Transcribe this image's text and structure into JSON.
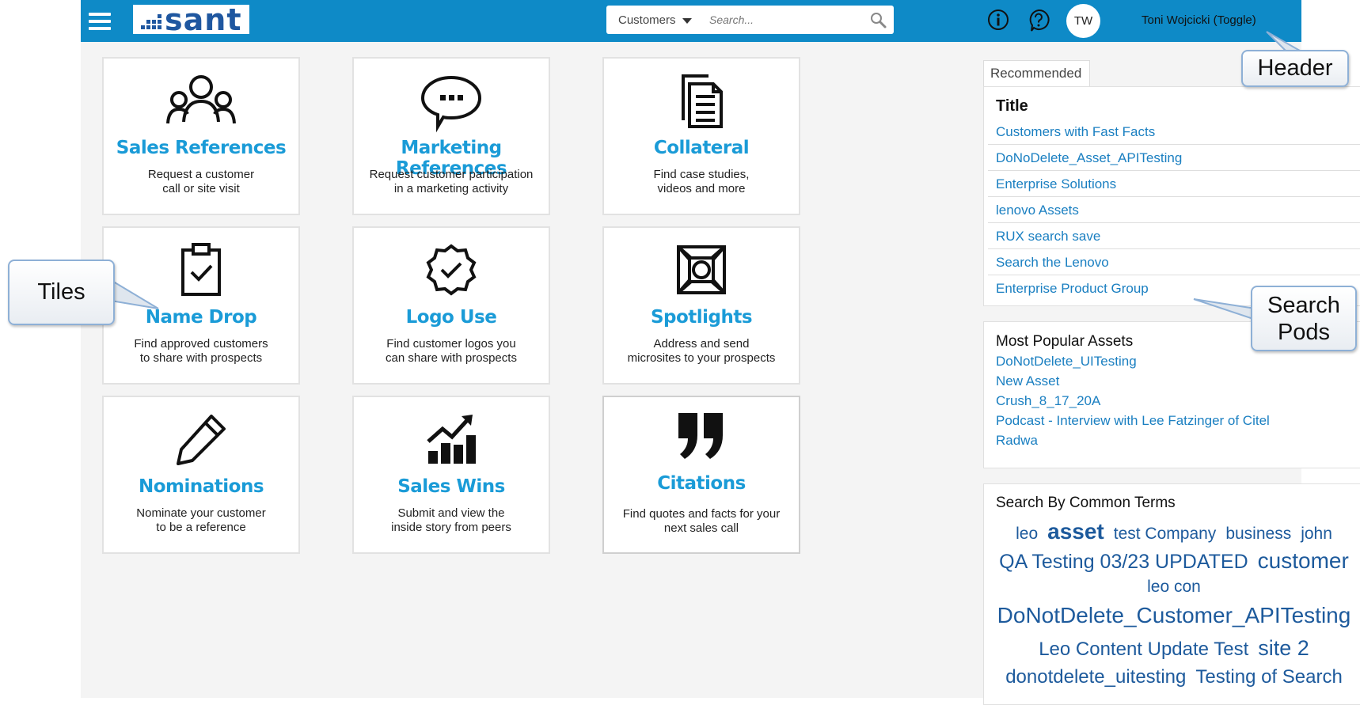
{
  "header": {
    "logo_text": "sant",
    "search_scope": "Customers",
    "search_placeholder": "Search...",
    "avatar_initials": "TW",
    "user_name": "Toni Wojcicki (Toggle)",
    "info_icon": "info-circle-icon",
    "help_icon": "question-bubble-icon"
  },
  "tiles": [
    {
      "icon": "people-icon",
      "title": "Sales References",
      "line1": "Request a customer",
      "line2": "call or site visit"
    },
    {
      "icon": "speech-bubble-icon",
      "title": "Marketing References",
      "line1": "Request customer participation",
      "line2": "in a marketing activity"
    },
    {
      "icon": "documents-icon",
      "title": "Collateral",
      "line1": "Find case studies,",
      "line2": "videos and more"
    },
    {
      "icon": "clipboard-check-icon",
      "title": "Name Drop",
      "line1": "Find approved customers",
      "line2": "to share with prospects"
    },
    {
      "icon": "badge-check-icon",
      "title": "Logo Use",
      "line1": "Find customer logos you",
      "line2": "can share with prospects"
    },
    {
      "icon": "spotlight-icon",
      "title": "Spotlights",
      "line1": "Address and send",
      "line2": "microsites to your prospects"
    },
    {
      "icon": "pencil-icon",
      "title": "Nominations",
      "line1": "Nominate your customer",
      "line2": "to be a reference"
    },
    {
      "icon": "growth-chart-icon",
      "title": "Sales Wins",
      "line1": "Submit and view the",
      "line2": "inside story from peers"
    },
    {
      "icon": "quote-icon",
      "title": "Citations",
      "line1": "Find quotes and facts for your",
      "line2": "next sales call"
    }
  ],
  "recommended": {
    "tab_label": "Recommended",
    "column_title": "Title",
    "items": [
      "Customers with Fast Facts",
      "DoNoDelete_Asset_APITesting",
      "Enterprise Solutions",
      "lenovo Assets",
      "RUX search save",
      "Search the Lenovo",
      "Enterprise Product Group"
    ]
  },
  "popular": {
    "title": "Most Popular Assets",
    "items": [
      "DoNotDelete_UITesting",
      "New Asset",
      "Crush_8_17_20A",
      "Podcast - Interview with Lee Fatzinger of Citel",
      "Radwa"
    ]
  },
  "common_terms": {
    "title": "Search By Common Terms",
    "terms": [
      "leo",
      "asset",
      "test Company",
      "business",
      "john",
      "QA Testing 03/23 UPDATED",
      "customer",
      "leo con",
      "DoNotDelete_Customer_APITesting",
      "Leo Content Update Test",
      "site 2",
      "donotdelete_uitesting",
      "Testing of Search"
    ]
  },
  "callouts": {
    "header": "Header",
    "tiles": "Tiles",
    "search_pods_1": "Search",
    "search_pods_2": "Pods"
  },
  "colors": {
    "header_bg": "#0e8ac7",
    "tile_title": "#1a9bd7",
    "link": "#1a7fc1",
    "tag": "#1d5a9c"
  }
}
